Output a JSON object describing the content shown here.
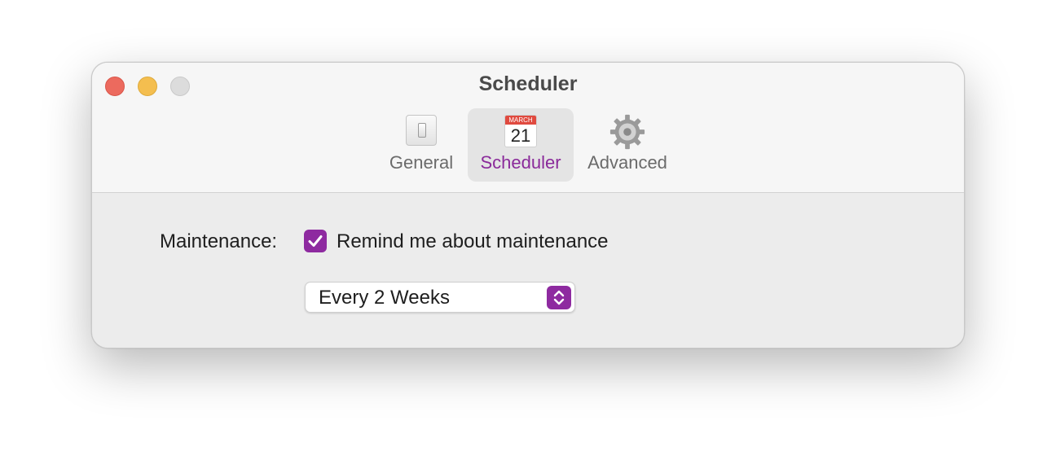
{
  "window": {
    "title": "Scheduler",
    "traffic_lights": [
      "close",
      "minimize",
      "zoom"
    ]
  },
  "toolbar": {
    "tabs": [
      {
        "label": "General",
        "icon": "switch-icon",
        "selected": false
      },
      {
        "label": "Scheduler",
        "icon": "calendar-icon",
        "selected": true,
        "calendar_month": "MARCH",
        "calendar_day": "21"
      },
      {
        "label": "Advanced",
        "icon": "gear-icon",
        "selected": false
      }
    ]
  },
  "maintenance": {
    "label": "Maintenance:",
    "checkbox_label": "Remind me about maintenance",
    "checked": true,
    "frequency": "Every 2 Weeks"
  },
  "colors": {
    "accent": "#8e2aa0",
    "close": "#ec6a5e",
    "minimize": "#f4be4f",
    "zoom": "#dcdcdc"
  }
}
